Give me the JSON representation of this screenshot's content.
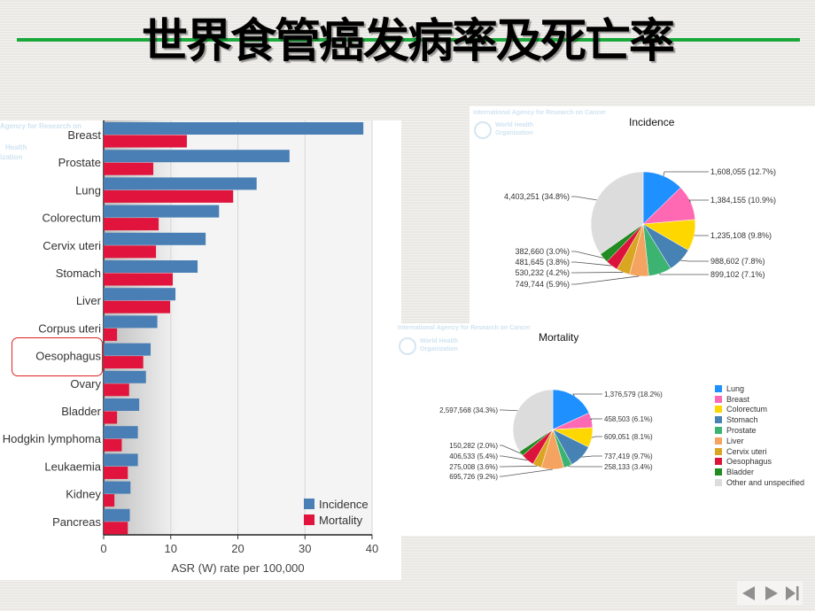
{
  "slide": {
    "title": "世界食管癌发病率及死亡率",
    "nav": {
      "prev_label": "previous",
      "next_label": "next",
      "end_label": "last"
    }
  },
  "watermarks": {
    "iarc": "International Agency for Research on Cancer",
    "iarc_short": "Agency for Research on",
    "who_line1": "World Health",
    "who_line2": "Organization",
    "who_short1": "Health",
    "who_short2": "ization"
  },
  "highlight": "Oesophagus",
  "chart_data": [
    {
      "type": "bar",
      "orientation": "horizontal",
      "title": "",
      "xlabel": "ASR (W) rate per 100,000",
      "ylabel": "",
      "xlim": [
        0,
        40
      ],
      "xticks": [
        0,
        10,
        20,
        30,
        40
      ],
      "grid": true,
      "legend_position": "bottom-right",
      "categories": [
        "Breast",
        "Prostate",
        "Lung",
        "Colorectum",
        "Cervix uteri",
        "Stomach",
        "Liver",
        "Corpus uteri",
        "Oesophagus",
        "Ovary",
        "Bladder",
        "Hodgkin lymphoma",
        "Leukaemia",
        "Kidney",
        "Pancreas"
      ],
      "series": [
        {
          "name": "Incidence",
          "color": "#4a7fb5",
          "values": [
            38.7,
            27.7,
            22.8,
            17.2,
            15.2,
            14.0,
            10.7,
            8.0,
            7.0,
            6.3,
            5.3,
            5.1,
            5.1,
            4.0,
            3.9
          ]
        },
        {
          "name": "Mortality",
          "color": "#e0143c",
          "values": [
            12.4,
            7.4,
            19.3,
            8.2,
            7.8,
            10.3,
            9.9,
            2.0,
            5.9,
            3.8,
            2.0,
            2.7,
            3.6,
            1.6,
            3.6
          ]
        }
      ]
    },
    {
      "type": "pie",
      "title": "Incidence",
      "slices": [
        {
          "label": "Lung",
          "value": 1608055,
          "text": "1,608,055 (12.7%)",
          "color": "#1e90ff"
        },
        {
          "label": "Breast",
          "value": 1384155,
          "text": "1,384,155 (10.9%)",
          "color": "#ff69b4"
        },
        {
          "label": "Colorectum",
          "value": 1235108,
          "text": "1,235,108 (9.8%)",
          "color": "#ffd700"
        },
        {
          "label": "Stomach",
          "value": 988602,
          "text": "988,602 (7.8%)",
          "color": "#4682b4"
        },
        {
          "label": "Prostate",
          "value": 899102,
          "text": "899,102 (7.1%)",
          "color": "#3cb371"
        },
        {
          "label": "Liver",
          "value": 749744,
          "text": "749,744 (5.9%)",
          "color": "#f4a460"
        },
        {
          "label": "Cervix uteri",
          "value": 530232,
          "text": "530,232 (4.2%)",
          "color": "#daa520"
        },
        {
          "label": "Oesophagus",
          "value": 481645,
          "text": "481,645 (3.8%)",
          "color": "#dc143c"
        },
        {
          "label": "Bladder",
          "value": 382660,
          "text": "382,660 (3.0%)",
          "color": "#228b22"
        },
        {
          "label": "Other and unspecified",
          "value": 4403251,
          "text": "4,403,251 (34.8%)",
          "color": "#dcdcdc"
        }
      ]
    },
    {
      "type": "pie",
      "title": "Mortality",
      "legend_position": "right",
      "slices": [
        {
          "label": "Lung",
          "value": 1376579,
          "text": "1,376,579 (18.2%)",
          "color": "#1e90ff"
        },
        {
          "label": "Breast",
          "value": 458503,
          "text": "458,503 (6.1%)",
          "color": "#ff69b4"
        },
        {
          "label": "Colorectum",
          "value": 609051,
          "text": "609,051 (8.1%)",
          "color": "#ffd700"
        },
        {
          "label": "Stomach",
          "value": 737419,
          "text": "737,419 (9.7%)",
          "color": "#4682b4"
        },
        {
          "label": "Prostate",
          "value": 258133,
          "text": "258,133 (3.4%)",
          "color": "#3cb371"
        },
        {
          "label": "Liver",
          "value": 695726,
          "text": "695,726 (9.2%)",
          "color": "#f4a460"
        },
        {
          "label": "Cervix uteri",
          "value": 275008,
          "text": "275,008 (3.6%)",
          "color": "#daa520"
        },
        {
          "label": "Oesophagus",
          "value": 406533,
          "text": "406,533 (5.4%)",
          "color": "#dc143c"
        },
        {
          "label": "Bladder",
          "value": 150282,
          "text": "150,282 (2.0%)",
          "color": "#228b22"
        },
        {
          "label": "Other and unspecified",
          "value": 2597568,
          "text": "2,597,568 (34.3%)",
          "color": "#dcdcdc"
        }
      ]
    }
  ]
}
